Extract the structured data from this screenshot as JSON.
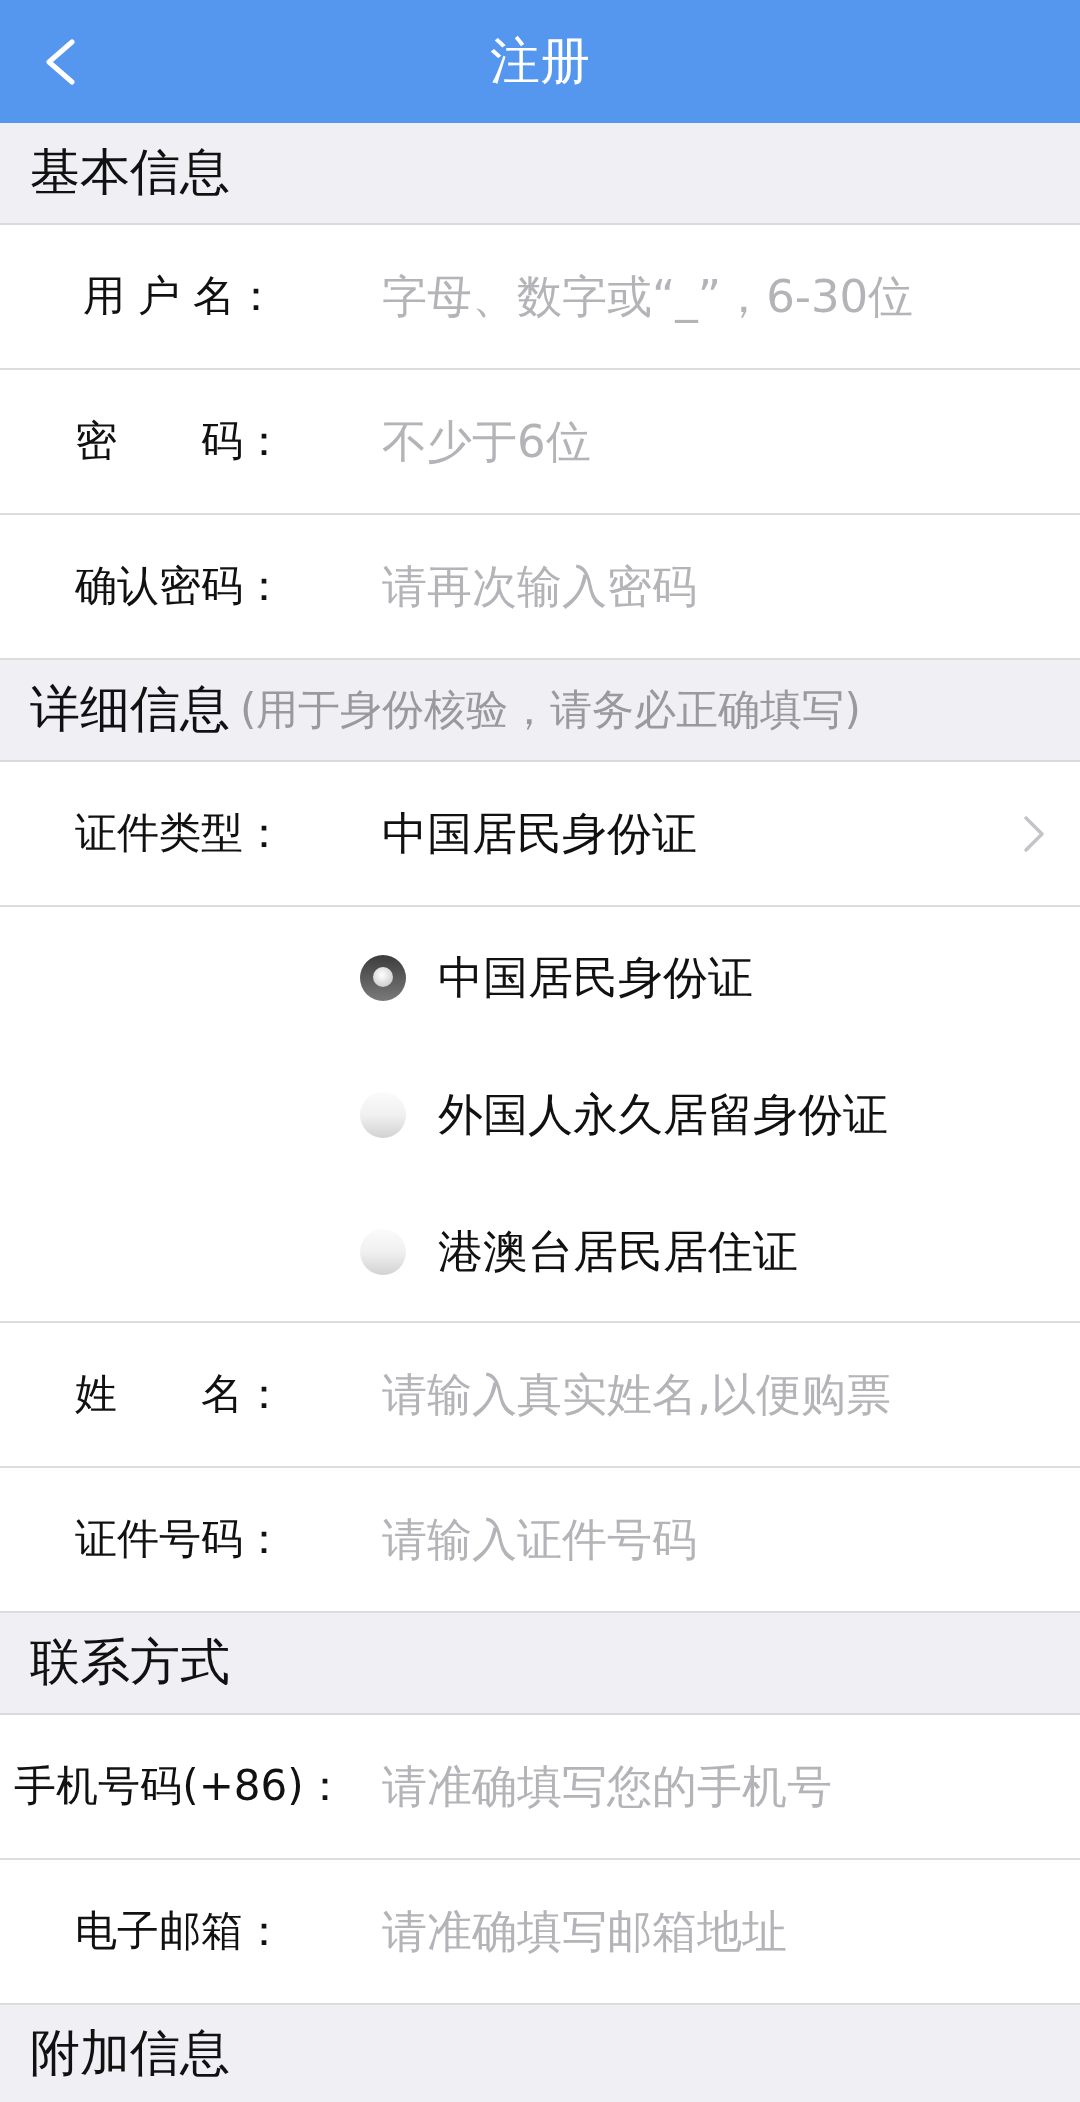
{
  "header": {
    "title": "注册"
  },
  "sections": [
    {
      "title": "基本信息",
      "rows": [
        {
          "kind": "input",
          "label": "用 户 名：",
          "placeholder": "字母、数字或“_”，6-30位"
        },
        {
          "kind": "input",
          "label": "密　　码：",
          "placeholder": "不少于6位"
        },
        {
          "kind": "input",
          "label": "确认密码：",
          "placeholder": "请再次输入密码"
        }
      ]
    },
    {
      "title": "详细信息",
      "note": "(用于身份核验，请务必正确填写)",
      "rows": [
        {
          "kind": "select",
          "label": "证件类型：",
          "value": "中国居民身份证"
        },
        {
          "kind": "radio",
          "options": [
            {
              "label": "中国居民身份证",
              "selected": true
            },
            {
              "label": "外国人永久居留身份证",
              "selected": false
            },
            {
              "label": "港澳台居民居住证",
              "selected": false
            }
          ]
        },
        {
          "kind": "input",
          "label": "姓　　名：",
          "placeholder": "请输入真实姓名,以便购票"
        },
        {
          "kind": "input",
          "label": "证件号码：",
          "placeholder": "请输入证件号码"
        }
      ]
    },
    {
      "title": "联系方式",
      "rows": [
        {
          "kind": "input",
          "label": "手机号码(+86)：",
          "placeholder": "请准确填写您的手机号"
        },
        {
          "kind": "input",
          "label": "电子邮箱：",
          "placeholder": "请准确填写邮箱地址"
        }
      ]
    },
    {
      "title": "附加信息"
    }
  ]
}
